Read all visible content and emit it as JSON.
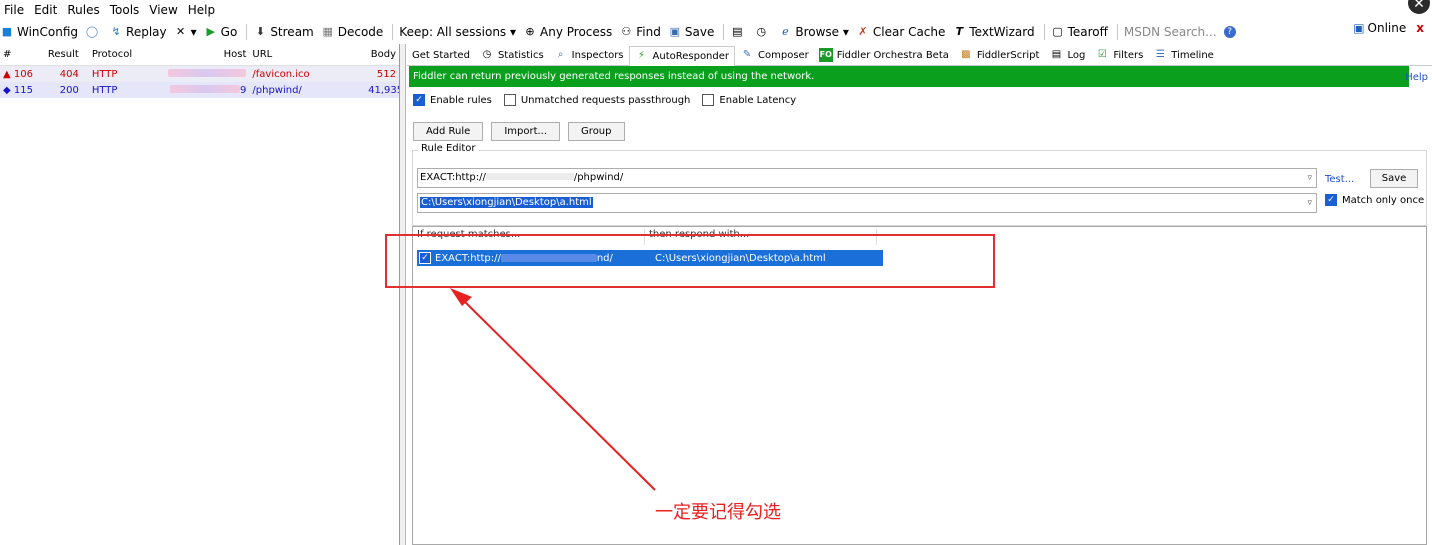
{
  "menu": [
    "File",
    "Edit",
    "Rules",
    "Tools",
    "View",
    "Help"
  ],
  "toolbar": {
    "items": [
      {
        "icon": "windows-icon",
        "label": "WinConfig"
      },
      {
        "icon": "comment-icon",
        "label": ""
      },
      {
        "icon": "replay-icon",
        "label": "Replay"
      },
      {
        "icon": "remove-icon",
        "label": "▾"
      },
      {
        "icon": "go-icon",
        "label": "Go"
      },
      {
        "icon": "stream-icon",
        "label": "Stream"
      },
      {
        "icon": "decode-icon",
        "label": "Decode"
      },
      {
        "icon": "",
        "label": "Keep: All sessions ▾"
      },
      {
        "icon": "crosshair-icon",
        "label": "Any Process"
      },
      {
        "icon": "binoculars-icon",
        "label": "Find"
      },
      {
        "icon": "save-icon",
        "label": "Save"
      },
      {
        "icon": "screenshot-icon",
        "label": ""
      },
      {
        "icon": "timer-icon",
        "label": ""
      },
      {
        "icon": "browser-icon",
        "label": "Browse ▾"
      },
      {
        "icon": "clear-cache-icon",
        "label": "Clear Cache"
      },
      {
        "icon": "textwizard-icon",
        "label": "TextWizard"
      },
      {
        "icon": "tearoff-icon",
        "label": "Tearoff"
      },
      {
        "icon": "",
        "label": "MSDN Search..."
      },
      {
        "icon": "help-icon",
        "label": ""
      }
    ],
    "online": "Online",
    "close": "x"
  },
  "sessions": {
    "columns": [
      "#",
      "Result",
      "Protocol",
      "Host",
      "URL",
      "Body"
    ],
    "rows": [
      {
        "id": "106",
        "result": "404",
        "protocol": "HTTP",
        "host": "",
        "url": "/favicon.ico",
        "body": "512",
        "status_icon": "warning-icon"
      },
      {
        "id": "115",
        "result": "200",
        "protocol": "HTTP",
        "host": "9",
        "url": "/phpwind/",
        "body": "41,935",
        "status_icon": "request-arrows-icon"
      }
    ]
  },
  "tabs": [
    {
      "label": "Get Started",
      "icon": ""
    },
    {
      "label": "Statistics",
      "icon": "timer-icon"
    },
    {
      "label": "Inspectors",
      "icon": "inspector-icon"
    },
    {
      "label": "AutoResponder",
      "icon": "lightning-icon",
      "active": true
    },
    {
      "label": "Composer",
      "icon": "composer-icon"
    },
    {
      "label": "Fiddler Orchestra Beta",
      "icon": "fo-icon"
    },
    {
      "label": "FiddlerScript",
      "icon": "script-icon"
    },
    {
      "label": "Log",
      "icon": "log-icon"
    },
    {
      "label": "Filters",
      "icon": "filter-icon"
    },
    {
      "label": "Timeline",
      "icon": "timeline-icon"
    }
  ],
  "autoresponder": {
    "banner": "Fiddler can return previously generated responses instead of using the network.",
    "help": "Help",
    "enable_rules": "Enable rules",
    "unmatched": "Unmatched requests passthrough",
    "latency": "Enable Latency",
    "add_rule": "Add Rule",
    "import": "Import...",
    "group": "Group",
    "rule_editor": "Rule Editor",
    "match_prefix": "EXACT:http://",
    "match_suffix": "/phpwind/",
    "response": "C:\\Users\\xiongjian\\Desktop\\a.html",
    "test": "Test...",
    "save": "Save",
    "match_once": "Match only once",
    "col_match": "If request matches...",
    "col_respond": "then respond with...",
    "rule_match_prefix": "EXACT:http://",
    "rule_match_suffix": "nd/",
    "rule_respond": "C:\\Users\\xiongjian\\Desktop\\a.html"
  },
  "annotation": "一定要记得勾选",
  "colors": {
    "banner": "#0aa01e",
    "highlight": "#e23030",
    "selection": "#1a6fd8"
  }
}
